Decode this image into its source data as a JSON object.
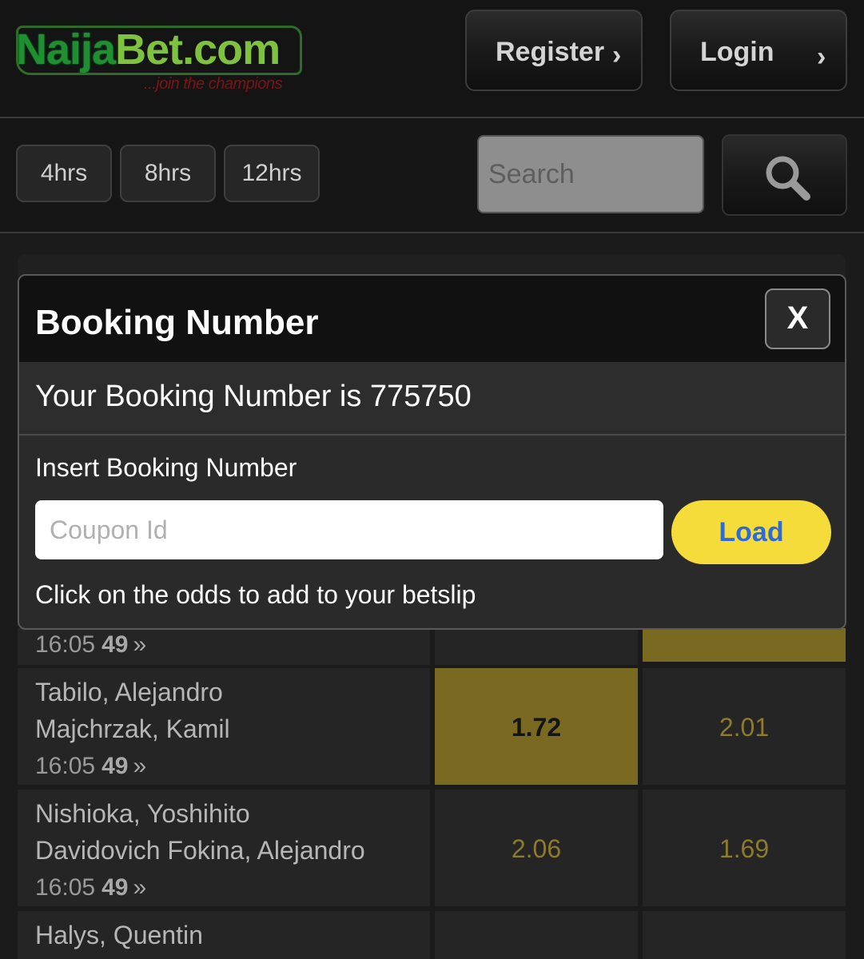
{
  "header": {
    "logo": {
      "part1": "Naija",
      "part2": "Bet.com",
      "tagline": "...join the champions"
    },
    "register_label": "Register",
    "login_label": "Login",
    "chevron": "›"
  },
  "filters": {
    "items": [
      "4hrs",
      "8hrs",
      "12hrs"
    ],
    "search_placeholder": "Search"
  },
  "modal": {
    "title": "Booking Number",
    "close_label": "X",
    "booking_message": "Your Booking Number is 775750",
    "insert_label": "Insert Booking Number",
    "coupon_placeholder": "Coupon Id",
    "load_label": "Load",
    "hint": "Click on the odds to add to your betslip"
  },
  "matches": [
    {
      "time": "16:05",
      "count": "49",
      "arrow": "»"
    },
    {
      "player1": "Tabilo, Alejandro",
      "player2": "Majchrzak, Kamil",
      "time": "16:05",
      "count": "49",
      "arrow": "»",
      "odd1": "1.72",
      "odd2": "2.01"
    },
    {
      "player1": "Nishioka, Yoshihito",
      "player2": "Davidovich Fokina, Alejandro",
      "time": "16:05",
      "count": "49",
      "arrow": "»",
      "odd1": "2.06",
      "odd2": "1.69"
    },
    {
      "player1": "Halys, Quentin"
    }
  ],
  "colors": {
    "selected_odd": "#7a6a21",
    "odd_text": "#8d7a2e",
    "load_button": "#f6dc3a",
    "load_text": "#2f6bd4"
  }
}
